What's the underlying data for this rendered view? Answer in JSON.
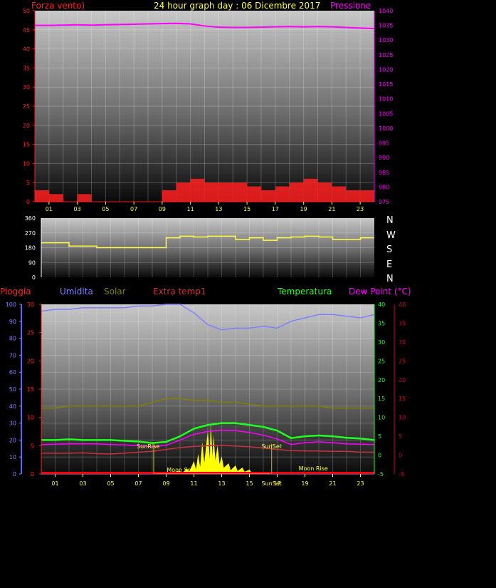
{
  "header": {
    "wind_label": "Forza vento)",
    "title": "24 hour graph day : 06 Dicembre 2017",
    "pressure_label": "Pressione"
  },
  "colors": {
    "wind": "#ff2020",
    "gust": "#cc0000",
    "pressure": "#ff00ff",
    "temperature": "#20ff20",
    "dewpoint": "#ff00ff",
    "humidity": "#8080ff",
    "solar": "#808000",
    "extra_temp": "#cc3040",
    "rain": "#6060ff",
    "direction": "#ffff40",
    "sun": "#ffff00"
  },
  "top_chart": {
    "left_ticks": [
      "50",
      "45",
      "40",
      "35",
      "30",
      "25",
      "20",
      "15",
      "10",
      "5",
      "0"
    ],
    "right_ticks": [
      "1040",
      "1035",
      "1030",
      "1025",
      "1020",
      "1015",
      "1010",
      "1005",
      "1000",
      "995",
      "990",
      "985",
      "980",
      "975"
    ],
    "x_ticks": [
      "01",
      "03",
      "05",
      "07",
      "09",
      "11",
      "13",
      "15",
      "17",
      "19",
      "21",
      "23"
    ]
  },
  "dir_chart": {
    "left_ticks": [
      "360",
      "270",
      "180",
      "90",
      "0"
    ],
    "compass": [
      "N",
      "W",
      "S",
      "E",
      "N"
    ]
  },
  "bottom_chart": {
    "labels": {
      "rain": "Pioggia",
      "humidity": "Umidita",
      "solar": "Solar",
      "extra": "Extra temp1",
      "temperature": "Temperatura",
      "dewpoint": "Dew Point (°C)"
    },
    "hum_ticks": [
      "100",
      "90",
      "80",
      "70",
      "60",
      "50",
      "40",
      "30",
      "20",
      "10",
      "0"
    ],
    "rain_ticks": [
      "30",
      "25",
      "20",
      "15",
      "10",
      "5",
      "0"
    ],
    "temp_ticks": [
      "40",
      "35",
      "30",
      "25",
      "20",
      "15",
      "10",
      "5",
      "0",
      "-5"
    ],
    "dew_ticks": [
      "40",
      "35",
      "30",
      "25",
      "20",
      "15",
      "10",
      "5",
      "0",
      "-5"
    ],
    "x_ticks": [
      "01",
      "03",
      "05",
      "07",
      "09",
      "11",
      "13",
      "15",
      "17",
      "19",
      "21",
      "23"
    ],
    "events": {
      "sunrise": "SunRise",
      "sunset": "SunSet",
      "moonrise": "Moon Rise",
      "moonset": "Moon Set",
      "sunset_axis": "SunSet"
    }
  },
  "chart_data": [
    {
      "type": "line",
      "title": "24 hour graph day : 06 Dicembre 2017",
      "x": [
        0,
        1,
        2,
        3,
        4,
        5,
        6,
        7,
        8,
        9,
        10,
        11,
        12,
        13,
        14,
        15,
        16,
        17,
        18,
        19,
        20,
        21,
        22,
        23,
        24
      ],
      "series": [
        {
          "name": "Pressione",
          "axis": "right",
          "values": [
            1035,
            1035,
            1035.1,
            1035.2,
            1035.1,
            1035.2,
            1035.3,
            1035.4,
            1035.5,
            1035.6,
            1035.7,
            1035.5,
            1034.8,
            1034.4,
            1034.3,
            1034.3,
            1034.4,
            1034.5,
            1034.6,
            1034.5,
            1034.6,
            1034.5,
            1034.3,
            1034.1,
            1033.9
          ]
        },
        {
          "name": "Forza vento)",
          "axis": "left",
          "values": [
            3,
            2,
            0,
            2,
            0,
            0,
            0,
            0,
            0,
            3,
            5,
            6,
            5,
            5,
            5,
            4,
            3,
            4,
            5,
            6,
            5,
            4,
            3,
            3,
            2
          ]
        }
      ],
      "ylim_left": [
        0,
        50
      ],
      "ylim_right": [
        975,
        1040
      ]
    },
    {
      "type": "line",
      "x": [
        0,
        1,
        2,
        3,
        4,
        5,
        6,
        7,
        8,
        9,
        10,
        11,
        12,
        13,
        14,
        15,
        16,
        17,
        18,
        19,
        20,
        21,
        22,
        23,
        24
      ],
      "series": [
        {
          "name": "direction",
          "values": [
            210,
            210,
            190,
            190,
            180,
            180,
            180,
            180,
            180,
            240,
            250,
            245,
            250,
            250,
            230,
            240,
            225,
            240,
            245,
            250,
            245,
            230,
            230,
            240,
            240
          ]
        }
      ],
      "ylim": [
        0,
        360
      ]
    },
    {
      "type": "line",
      "x": [
        0,
        1,
        2,
        3,
        4,
        5,
        6,
        7,
        8,
        9,
        10,
        11,
        12,
        13,
        14,
        15,
        16,
        17,
        18,
        19,
        20,
        21,
        22,
        23,
        24
      ],
      "series": [
        {
          "name": "Umidita",
          "axis": "humidity",
          "values": [
            96,
            97,
            97,
            98,
            98,
            98,
            98,
            99,
            99,
            100,
            100,
            95,
            88,
            85,
            86,
            86,
            87,
            86,
            90,
            92,
            94,
            94,
            93,
            92,
            94
          ]
        },
        {
          "name": "Temperatura",
          "axis": "temp",
          "values": [
            4,
            4,
            4.2,
            4,
            4,
            4,
            3.8,
            3.6,
            3.2,
            3.5,
            5,
            7,
            8,
            8.5,
            8.5,
            8,
            7.5,
            6.5,
            4.5,
            5,
            5.2,
            5,
            4.6,
            4.4,
            4
          ]
        },
        {
          "name": "Dew Point (°C)",
          "axis": "temp",
          "values": [
            2.8,
            2.9,
            3,
            3,
            3,
            2.8,
            2.7,
            2.5,
            2.2,
            2.6,
            4,
            5.5,
            6.3,
            6.6,
            6.5,
            6,
            5.3,
            4.3,
            2.8,
            3.3,
            3.5,
            3.3,
            3,
            2.9,
            2.8
          ]
        },
        {
          "name": "Solar",
          "axis": "temp",
          "values": [
            12.5,
            12.5,
            13,
            13,
            13,
            13,
            13,
            13,
            14,
            15,
            15,
            14.5,
            14.5,
            14,
            14,
            13.5,
            13,
            13,
            13,
            13,
            13,
            12.5,
            12.5,
            12.5,
            12.5
          ]
        },
        {
          "name": "Extra temp1",
          "axis": "temp",
          "values": [
            0.5,
            0.5,
            0.5,
            0.6,
            0.4,
            0.3,
            0.5,
            0.8,
            1,
            1.5,
            2,
            2.3,
            2.5,
            2.6,
            2.4,
            2.2,
            1.9,
            1.5,
            1.2,
            1.1,
            1.1,
            1,
            1,
            0.8,
            0.8
          ]
        },
        {
          "name": "Pioggia",
          "axis": "rain",
          "values": [
            0,
            0,
            0,
            0,
            0,
            0,
            0,
            0,
            0,
            0,
            0,
            0,
            0,
            0,
            0,
            0,
            0,
            0,
            0,
            0,
            0,
            0,
            0,
            0,
            0
          ]
        }
      ],
      "ylim_humidity": [
        0,
        100
      ],
      "ylim_rain": [
        0,
        30
      ],
      "ylim_temp": [
        -5,
        40
      ]
    }
  ]
}
